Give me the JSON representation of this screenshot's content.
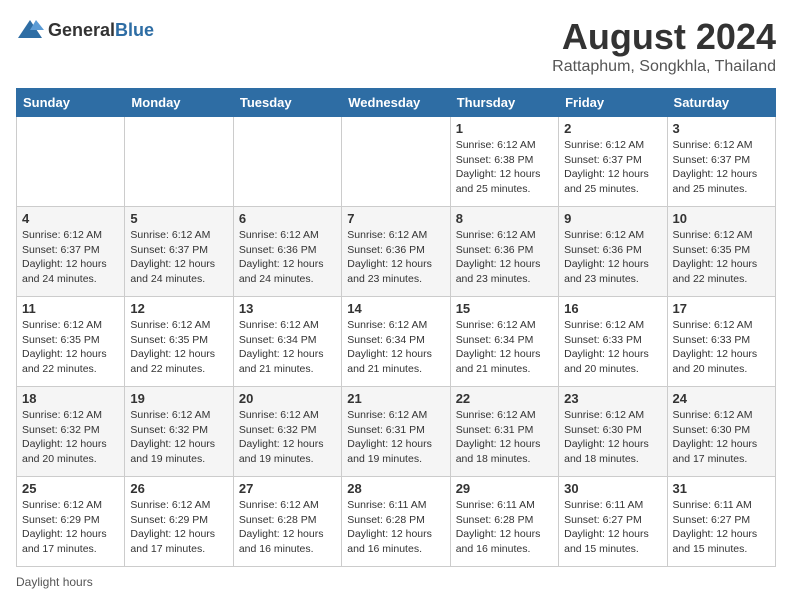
{
  "header": {
    "logo_general": "General",
    "logo_blue": "Blue",
    "month_title": "August 2024",
    "location": "Rattaphum, Songkhla, Thailand"
  },
  "days_of_week": [
    "Sunday",
    "Monday",
    "Tuesday",
    "Wednesday",
    "Thursday",
    "Friday",
    "Saturday"
  ],
  "weeks": [
    [
      {
        "day": "",
        "info": ""
      },
      {
        "day": "",
        "info": ""
      },
      {
        "day": "",
        "info": ""
      },
      {
        "day": "",
        "info": ""
      },
      {
        "day": "1",
        "info": "Sunrise: 6:12 AM\nSunset: 6:38 PM\nDaylight: 12 hours\nand 25 minutes."
      },
      {
        "day": "2",
        "info": "Sunrise: 6:12 AM\nSunset: 6:37 PM\nDaylight: 12 hours\nand 25 minutes."
      },
      {
        "day": "3",
        "info": "Sunrise: 6:12 AM\nSunset: 6:37 PM\nDaylight: 12 hours\nand 25 minutes."
      }
    ],
    [
      {
        "day": "4",
        "info": "Sunrise: 6:12 AM\nSunset: 6:37 PM\nDaylight: 12 hours\nand 24 minutes."
      },
      {
        "day": "5",
        "info": "Sunrise: 6:12 AM\nSunset: 6:37 PM\nDaylight: 12 hours\nand 24 minutes."
      },
      {
        "day": "6",
        "info": "Sunrise: 6:12 AM\nSunset: 6:36 PM\nDaylight: 12 hours\nand 24 minutes."
      },
      {
        "day": "7",
        "info": "Sunrise: 6:12 AM\nSunset: 6:36 PM\nDaylight: 12 hours\nand 23 minutes."
      },
      {
        "day": "8",
        "info": "Sunrise: 6:12 AM\nSunset: 6:36 PM\nDaylight: 12 hours\nand 23 minutes."
      },
      {
        "day": "9",
        "info": "Sunrise: 6:12 AM\nSunset: 6:36 PM\nDaylight: 12 hours\nand 23 minutes."
      },
      {
        "day": "10",
        "info": "Sunrise: 6:12 AM\nSunset: 6:35 PM\nDaylight: 12 hours\nand 22 minutes."
      }
    ],
    [
      {
        "day": "11",
        "info": "Sunrise: 6:12 AM\nSunset: 6:35 PM\nDaylight: 12 hours\nand 22 minutes."
      },
      {
        "day": "12",
        "info": "Sunrise: 6:12 AM\nSunset: 6:35 PM\nDaylight: 12 hours\nand 22 minutes."
      },
      {
        "day": "13",
        "info": "Sunrise: 6:12 AM\nSunset: 6:34 PM\nDaylight: 12 hours\nand 21 minutes."
      },
      {
        "day": "14",
        "info": "Sunrise: 6:12 AM\nSunset: 6:34 PM\nDaylight: 12 hours\nand 21 minutes."
      },
      {
        "day": "15",
        "info": "Sunrise: 6:12 AM\nSunset: 6:34 PM\nDaylight: 12 hours\nand 21 minutes."
      },
      {
        "day": "16",
        "info": "Sunrise: 6:12 AM\nSunset: 6:33 PM\nDaylight: 12 hours\nand 20 minutes."
      },
      {
        "day": "17",
        "info": "Sunrise: 6:12 AM\nSunset: 6:33 PM\nDaylight: 12 hours\nand 20 minutes."
      }
    ],
    [
      {
        "day": "18",
        "info": "Sunrise: 6:12 AM\nSunset: 6:32 PM\nDaylight: 12 hours\nand 20 minutes."
      },
      {
        "day": "19",
        "info": "Sunrise: 6:12 AM\nSunset: 6:32 PM\nDaylight: 12 hours\nand 19 minutes."
      },
      {
        "day": "20",
        "info": "Sunrise: 6:12 AM\nSunset: 6:32 PM\nDaylight: 12 hours\nand 19 minutes."
      },
      {
        "day": "21",
        "info": "Sunrise: 6:12 AM\nSunset: 6:31 PM\nDaylight: 12 hours\nand 19 minutes."
      },
      {
        "day": "22",
        "info": "Sunrise: 6:12 AM\nSunset: 6:31 PM\nDaylight: 12 hours\nand 18 minutes."
      },
      {
        "day": "23",
        "info": "Sunrise: 6:12 AM\nSunset: 6:30 PM\nDaylight: 12 hours\nand 18 minutes."
      },
      {
        "day": "24",
        "info": "Sunrise: 6:12 AM\nSunset: 6:30 PM\nDaylight: 12 hours\nand 17 minutes."
      }
    ],
    [
      {
        "day": "25",
        "info": "Sunrise: 6:12 AM\nSunset: 6:29 PM\nDaylight: 12 hours\nand 17 minutes."
      },
      {
        "day": "26",
        "info": "Sunrise: 6:12 AM\nSunset: 6:29 PM\nDaylight: 12 hours\nand 17 minutes."
      },
      {
        "day": "27",
        "info": "Sunrise: 6:12 AM\nSunset: 6:28 PM\nDaylight: 12 hours\nand 16 minutes."
      },
      {
        "day": "28",
        "info": "Sunrise: 6:11 AM\nSunset: 6:28 PM\nDaylight: 12 hours\nand 16 minutes."
      },
      {
        "day": "29",
        "info": "Sunrise: 6:11 AM\nSunset: 6:28 PM\nDaylight: 12 hours\nand 16 minutes."
      },
      {
        "day": "30",
        "info": "Sunrise: 6:11 AM\nSunset: 6:27 PM\nDaylight: 12 hours\nand 15 minutes."
      },
      {
        "day": "31",
        "info": "Sunrise: 6:11 AM\nSunset: 6:27 PM\nDaylight: 12 hours\nand 15 minutes."
      }
    ]
  ],
  "footer": {
    "note": "Daylight hours"
  }
}
